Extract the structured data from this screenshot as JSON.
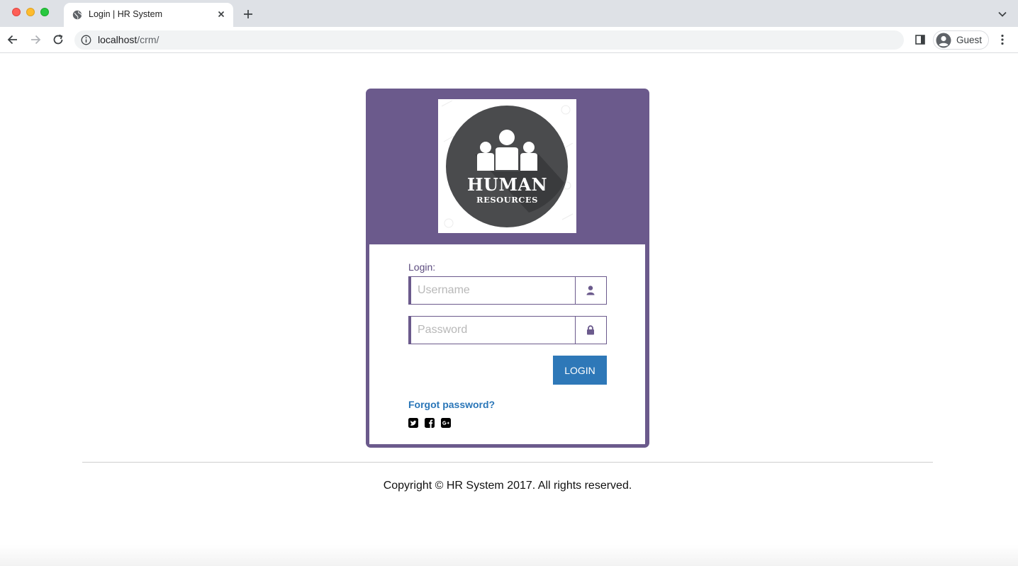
{
  "browser": {
    "tab_title": "Login | HR System",
    "url_host": "localhost",
    "url_path": "/crm/",
    "profile_label": "Guest",
    "icons": [
      "globe-icon",
      "close-icon",
      "plus-icon",
      "chevron-down-icon",
      "back-arrow-icon",
      "forward-arrow-icon",
      "reload-icon",
      "info-icon",
      "side-panel-icon",
      "avatar-icon",
      "kebab-menu-icon"
    ]
  },
  "logo": {
    "title": "HUMAN",
    "subtitle": "RESOURCES",
    "icon": "people-group-icon"
  },
  "login_form": {
    "label": "Login:",
    "username_placeholder": "Username",
    "username_value": "",
    "password_placeholder": "Password",
    "password_value": "",
    "submit_label": "LOGIN",
    "forgot_password": "Forgot password?",
    "social_icons": [
      "twitter-icon",
      "facebook-icon",
      "google-plus-icon"
    ]
  },
  "footer": {
    "copyright": "Copyright © HR System 2017. All rights reserved."
  },
  "colors": {
    "card_purple": "#6b5a8c",
    "button_blue": "#2e78b8",
    "link_blue": "#2a76b8"
  }
}
